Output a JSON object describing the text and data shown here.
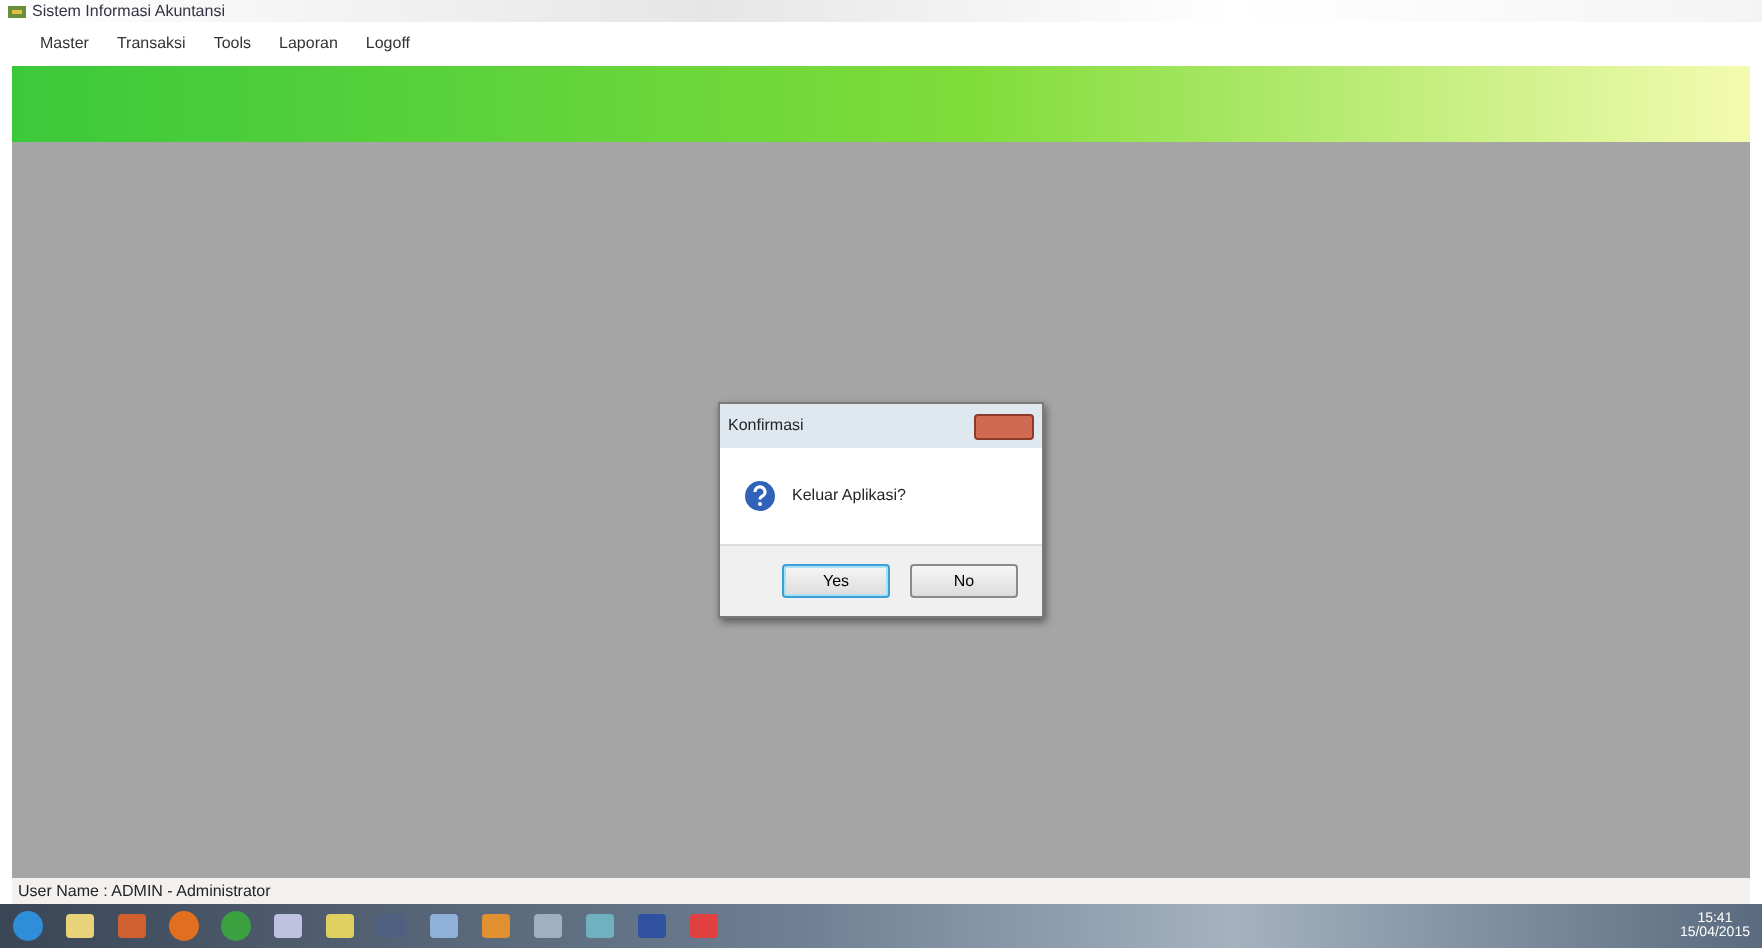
{
  "window": {
    "title": "Sistem Informasi Akuntansi"
  },
  "menu": [
    "Master",
    "Transaksi",
    "Tools",
    "Laporan",
    "Logoff"
  ],
  "dialog": {
    "title": "Konfirmasi",
    "message": "Keluar Aplikasi?",
    "buttons": [
      {
        "label": "Yes",
        "selected": true
      },
      {
        "label": "No",
        "selected": false
      }
    ]
  },
  "status_bar": "User Name : ADMIN - Administrator",
  "taskbar": {
    "time": "15:41",
    "date": "15/04/2015"
  }
}
